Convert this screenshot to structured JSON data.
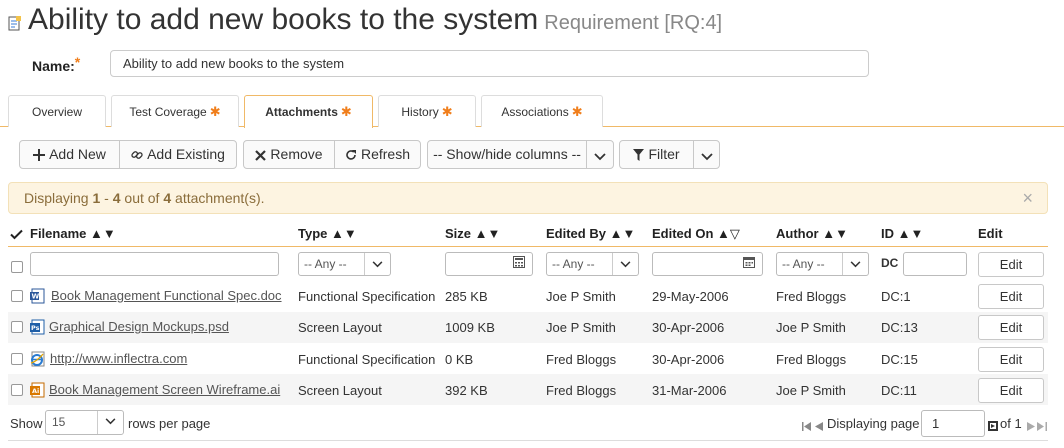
{
  "page": {
    "title": "Ability to add new books to the system",
    "subtitle": "Requirement [RQ:4]"
  },
  "form": {
    "name_label": "Name:",
    "required_mark": "*",
    "name_value": "Ability to add new books to the system"
  },
  "tabs": [
    {
      "label": "Overview",
      "star": ""
    },
    {
      "label": "Test Coverage",
      "star": "✱"
    },
    {
      "label": "Attachments",
      "star": "✱"
    },
    {
      "label": "History",
      "star": "✱"
    },
    {
      "label": "Associations",
      "star": "✱"
    }
  ],
  "toolbar": {
    "add_new": "Add New",
    "add_existing": "Add Existing",
    "remove": "Remove",
    "refresh": "Refresh",
    "show_hide_columns": "-- Show/hide columns --",
    "filter": "Filter"
  },
  "alert": {
    "prefix": "Displaying ",
    "from": "1",
    "sep": " - ",
    "to": "4",
    "mid": " out of ",
    "total": "4",
    "suffix": " attachment(s).",
    "close": "×"
  },
  "grid": {
    "columns": {
      "filename": "Filename",
      "type": "Type",
      "size": "Size",
      "edited_by": "Edited By",
      "edited_on": "Edited On",
      "author": "Author",
      "id": "ID",
      "edit": "Edit"
    },
    "sort_arrows": "▲▼",
    "sort_arrows_desc": "▲▽",
    "filters": {
      "any": "-- Any --",
      "id_prefix": "DC",
      "edit": "Edit"
    },
    "rows": [
      {
        "filename": "Book Management Functional Spec.doc",
        "icon": "word-doc-icon",
        "type": "Functional Specification",
        "size": "285 KB",
        "edited_by": "Joe P Smith",
        "edited_on": "29-May-2006",
        "author": "Fred Bloggs",
        "id": "DC:1",
        "edit": "Edit"
      },
      {
        "filename": "Graphical Design Mockups.psd",
        "icon": "photoshop-file-icon",
        "type": "Screen Layout",
        "size": "1009 KB",
        "edited_by": "Joe P Smith",
        "edited_on": "30-Apr-2006",
        "author": "Joe P Smith",
        "id": "DC:13",
        "edit": "Edit"
      },
      {
        "filename": "http://www.inflectra.com",
        "icon": "web-link-icon",
        "type": "Functional Specification",
        "size": "0 KB",
        "edited_by": "Fred Bloggs",
        "edited_on": "30-Apr-2006",
        "author": "Fred Bloggs",
        "id": "DC:15",
        "edit": "Edit"
      },
      {
        "filename": "Book Management Screen Wireframe.ai",
        "icon": "illustrator-file-icon",
        "type": "Screen Layout",
        "size": "392 KB",
        "edited_by": "Fred Bloggs",
        "edited_on": "31-Mar-2006",
        "author": "Joe P Smith",
        "id": "DC:11",
        "edit": "Edit"
      }
    ]
  },
  "footer": {
    "show": "Show",
    "rows_per_page": "15",
    "rows_suffix": "rows per page",
    "displaying_page": "Displaying page",
    "page": "1",
    "of": "of 1"
  },
  "colors": {
    "accent": "#f07e1b",
    "tab_border": "#f0b967",
    "alert_bg": "#fdf4e1",
    "alt_row": "#f5f5f5"
  }
}
